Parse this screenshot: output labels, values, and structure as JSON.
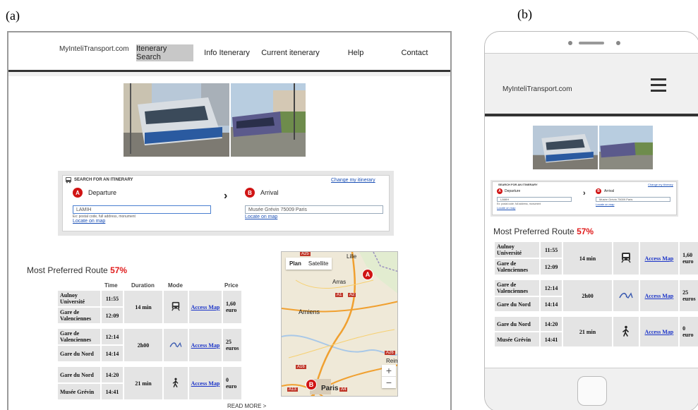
{
  "labels": {
    "a": "(a)",
    "b": "(b)"
  },
  "colors": {
    "accent_red": "#e01b1b",
    "pin_red": "#d01414",
    "link_blue": "#1a33c8",
    "nav_active_bg": "#c8c8c8",
    "row_bg": "#e4e4e4"
  },
  "desktop": {
    "logo": "MyInteliTransport.com",
    "nav": [
      {
        "label": "Itenerary Search",
        "active": true
      },
      {
        "label": "Info Itenerary",
        "active": false
      },
      {
        "label": "Current itenerary",
        "active": false
      },
      {
        "label": "Help",
        "active": false
      },
      {
        "label": "Contact",
        "active": false
      }
    ],
    "read_more": "READ MORE >"
  },
  "mobile": {
    "logo": "MyInteliTransport.com",
    "menu_icon": "hamburger-icon"
  },
  "search": {
    "title": "SEARCH FOR AN ITINERARY",
    "change_link": "Change my itinerary",
    "departure": {
      "pin": "A",
      "label": "Departure",
      "value": "LAMIH",
      "hint": "Ex: postal code, full address, monument",
      "locate": "Locate on map"
    },
    "arrival": {
      "pin": "B",
      "label": "Arrival",
      "value": "Musée Grévin 75009 Paris",
      "locate": "Locate on map"
    }
  },
  "route": {
    "title": "Most Preferred Route",
    "percent": "57%",
    "columns": [
      "Time",
      "Duration",
      "Mode",
      "Price"
    ],
    "access_label": "Access Map",
    "legs": [
      {
        "from": "Aulnoy Université",
        "from_time": "11:55",
        "to": "Gare de Valenciennes",
        "to_time": "12:09",
        "duration": "14 min",
        "mode": "tram-icon",
        "price_value": "1,60",
        "price_unit": "euro"
      },
      {
        "from": "Gare de Valenciennes",
        "from_time": "12:14",
        "to": "Gare du Nord",
        "to_time": "14:14",
        "duration": "2h00",
        "mode": "tgv-train-icon",
        "price_value": "25",
        "price_unit": "euros"
      },
      {
        "from": "Gare du Nord",
        "from_time": "14:20",
        "to": "Musée Grévin",
        "to_time": "14:41",
        "duration": "21 min",
        "mode": "walking-icon",
        "price_value": "0",
        "price_unit": "euro"
      }
    ]
  },
  "map": {
    "tabs": [
      "Plan",
      "Satellite"
    ],
    "cities": [
      "Lille",
      "Arras",
      "Amiens",
      "Paris",
      "Reim"
    ],
    "roads": [
      "A25",
      "A1",
      "A2",
      "A26",
      "A16",
      "A4",
      "A13"
    ],
    "markers": [
      "A",
      "B"
    ],
    "zoom_in": "+",
    "zoom_out": "−"
  }
}
